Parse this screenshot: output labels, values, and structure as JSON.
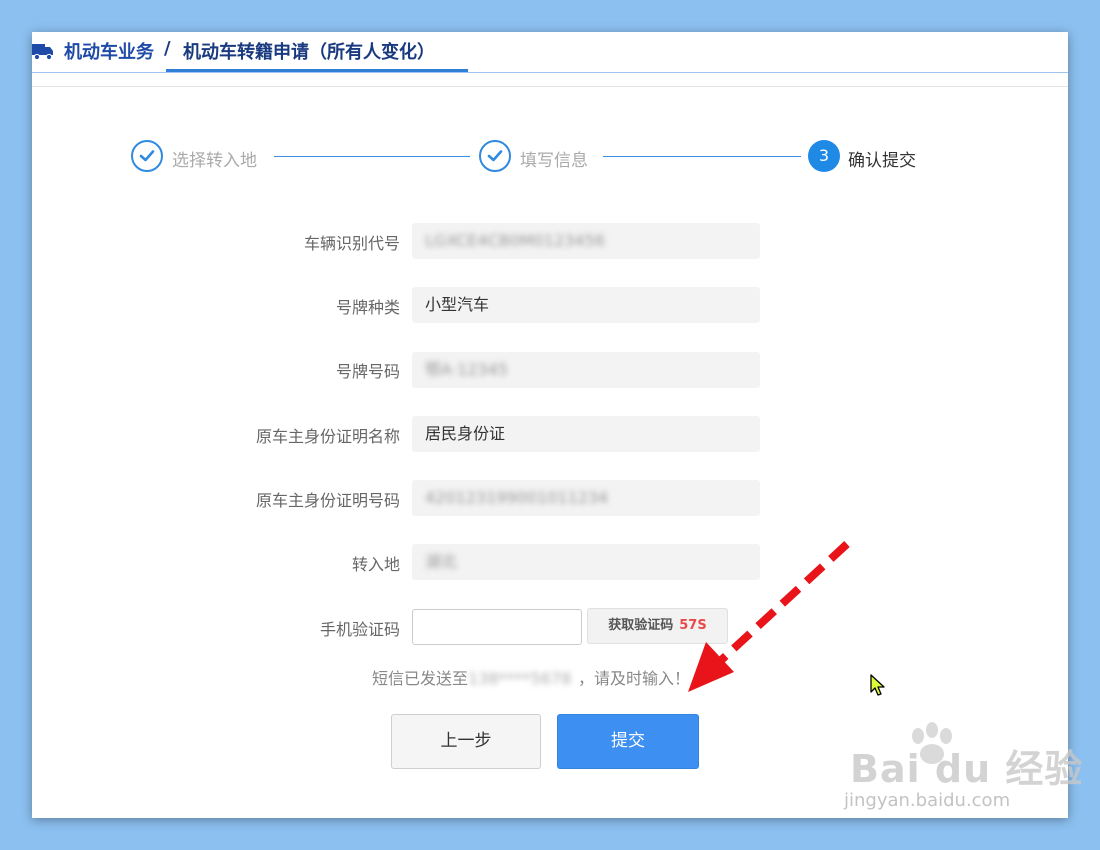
{
  "header": {
    "breadcrumb_section": "机动车业务",
    "separator": "/",
    "breadcrumb_page": "机动车转籍申请（所有人变化）"
  },
  "steps": [
    {
      "label": "选择转入地",
      "status": "done"
    },
    {
      "label": "填写信息",
      "status": "done"
    },
    {
      "number": "3",
      "label": "确认提交",
      "status": "current"
    }
  ],
  "form": {
    "vin": {
      "label": "车辆识别代号",
      "value": ""
    },
    "plate_type": {
      "label": "号牌种类",
      "value": "小型汽车"
    },
    "plate_number": {
      "label": "号牌号码",
      "value": ""
    },
    "id_type": {
      "label": "原车主身份证明名称",
      "value": "居民身份证"
    },
    "id_number": {
      "label": "原车主身份证明号码",
      "value": ""
    },
    "destination": {
      "label": "转入地",
      "value": ""
    },
    "sms_code": {
      "label": "手机验证码",
      "value": "",
      "button_label": "获取验证码",
      "countdown": "57S"
    },
    "sms_tip_prefix": "短信已发送至",
    "sms_tip_suffix": "，请及时输入！"
  },
  "buttons": {
    "prev": "上一步",
    "submit": "提交"
  },
  "watermark": {
    "brand": "Bai du 经验",
    "url": "jingyan.baidu.com"
  },
  "colors": {
    "accent": "#3d8ff2",
    "step_blue": "#1f8ae6",
    "annotation_arrow": "#e8141a",
    "countdown": "#e84a4a"
  },
  "icons": {
    "breadcrumb": "truck-icon",
    "step_done": "check-circle-icon",
    "annotation": "dashed-arrow-icon",
    "cursor": "mouse-pointer-icon"
  }
}
